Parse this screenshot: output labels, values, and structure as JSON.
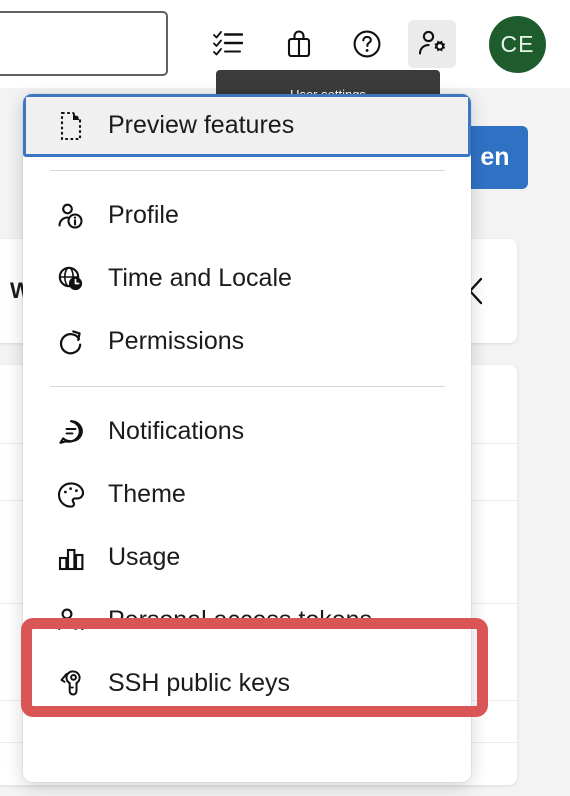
{
  "topbar": {
    "search": {
      "value": "",
      "placeholder": ""
    },
    "icons": [
      {
        "name": "task-list-icon",
        "label": "Tasks"
      },
      {
        "name": "briefcase-icon",
        "label": "Work"
      },
      {
        "name": "help-circle-icon",
        "label": "Help"
      },
      {
        "name": "user-settings-icon",
        "label": "User settings"
      }
    ],
    "avatar_initials": "CE",
    "tooltip_text": "User settings"
  },
  "background": {
    "primary_button_label": "en",
    "card_title": "W",
    "collapse_icon": "chevron-left-icon"
  },
  "menu": {
    "groups": [
      {
        "items": [
          {
            "label": "Preview features",
            "icon": "dashed-document-icon",
            "focused": true
          }
        ]
      },
      {
        "items": [
          {
            "label": "Profile",
            "icon": "person-info-icon",
            "focused": false
          },
          {
            "label": "Time and Locale",
            "icon": "globe-clock-icon",
            "focused": false
          },
          {
            "label": "Permissions",
            "icon": "refresh-icon",
            "focused": false
          }
        ]
      },
      {
        "items": [
          {
            "label": "Notifications",
            "icon": "speech-bubble-icon",
            "focused": false
          },
          {
            "label": "Theme",
            "icon": "palette-icon",
            "focused": false
          },
          {
            "label": "Usage",
            "icon": "bar-chart-icon",
            "focused": false
          },
          {
            "label": "Personal access tokens",
            "icon": "person-key-icon",
            "focused": false,
            "highlighted": true
          },
          {
            "label": "SSH public keys",
            "icon": "key-icon",
            "focused": false
          }
        ]
      }
    ]
  },
  "colors": {
    "accent_blue": "#2f72c4",
    "focus_blue": "#3b78c3",
    "highlight_red": "#da5656",
    "avatar_green": "#1e5c2e",
    "tooltip_dark": "#3b3b3b"
  }
}
